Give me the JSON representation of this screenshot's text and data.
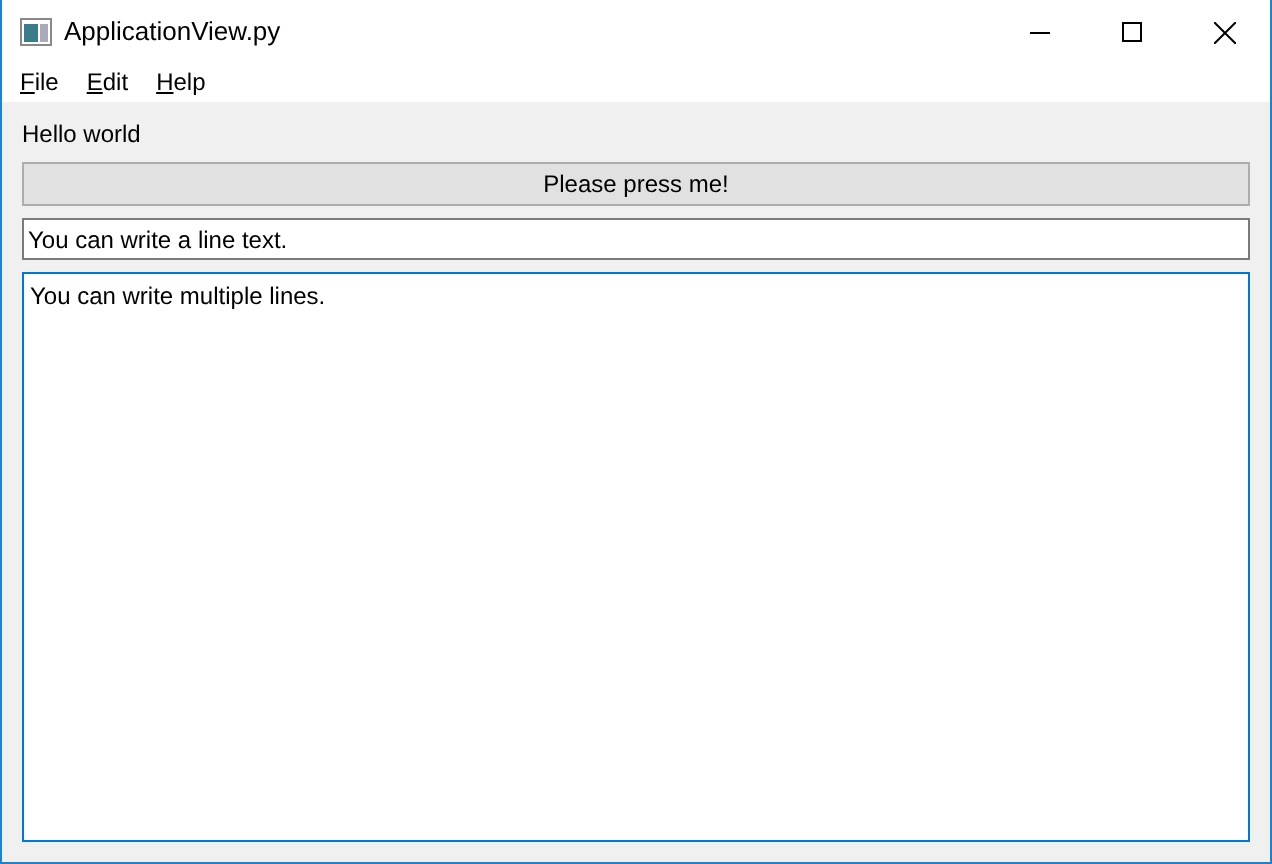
{
  "window": {
    "title": "ApplicationView.py"
  },
  "menu": [
    {
      "accel": "F",
      "rest": "ile"
    },
    {
      "accel": "E",
      "rest": "dit"
    },
    {
      "accel": "H",
      "rest": "elp"
    }
  ],
  "label": "Hello world",
  "button": {
    "label": "Please press me!"
  },
  "line_edit": {
    "value": "You can write a line text.",
    "focused": false
  },
  "text_edit": {
    "value": "You can write multiple lines.",
    "focused": true
  }
}
